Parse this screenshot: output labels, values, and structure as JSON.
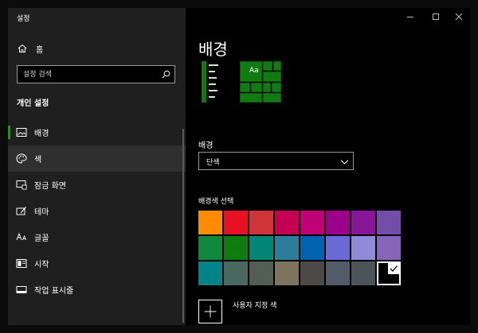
{
  "app": {
    "title": "설정"
  },
  "sidebar": {
    "home_label": "홈",
    "search_placeholder": "설정 검색",
    "section_title": "개인 설정",
    "items": [
      {
        "id": "background",
        "label": "배경",
        "icon": "image-icon",
        "selected": true
      },
      {
        "id": "colors",
        "label": "색",
        "icon": "palette-icon",
        "hover": true
      },
      {
        "id": "lockscreen",
        "label": "잠금 화면",
        "icon": "lock-screen-icon"
      },
      {
        "id": "themes",
        "label": "테마",
        "icon": "theme-brush-icon"
      },
      {
        "id": "fonts",
        "label": "글꼴",
        "icon": "font-icon"
      },
      {
        "id": "start",
        "label": "시작",
        "icon": "start-icon"
      },
      {
        "id": "taskbar",
        "label": "작업 표시줄",
        "icon": "taskbar-icon"
      }
    ]
  },
  "content": {
    "title": "배경",
    "background_label": "배경",
    "background_value": "단색",
    "choose_color_label": "배경색 선택",
    "custom_color_label": "사용자 지정 색",
    "colors": {
      "accent": "#107c10",
      "swatches": [
        "#ff8c00",
        "#e81123",
        "#d13438",
        "#c30052",
        "#bf0077",
        "#9a0089",
        "#881798",
        "#744da9",
        "#10893e",
        "#107c10",
        "#018574",
        "#2d7d9a",
        "#0063b1",
        "#6b69d6",
        "#8e8cd8",
        "#8764b8",
        "#038387",
        "#486860",
        "#525e54",
        "#7e735f",
        "#4c4a48",
        "#515c6b",
        "#4a5459",
        "#000000"
      ],
      "selected_index": 23
    }
  }
}
